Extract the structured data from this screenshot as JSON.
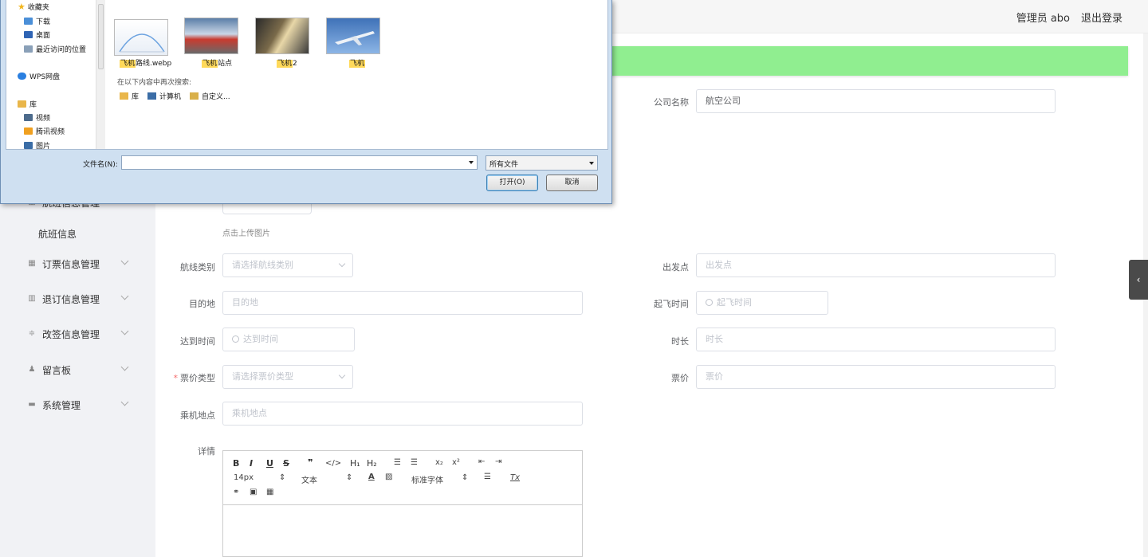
{
  "header": {
    "admin": "管理员 abo",
    "logout": "退出登录"
  },
  "sidebar": {
    "partial_item": "航班信息管理",
    "sub_item": "航班信息",
    "items": [
      {
        "label": "订票信息管理",
        "icon": "grid-icon"
      },
      {
        "label": "退订信息管理",
        "icon": "bars-icon"
      },
      {
        "label": "改签信息管理",
        "icon": "sliders-icon"
      },
      {
        "label": "留言板",
        "icon": "user-icon"
      },
      {
        "label": "系统管理",
        "icon": "system-icon"
      }
    ]
  },
  "form": {
    "company": {
      "label": "公司名称",
      "value": "航空公司"
    },
    "upload_hint": "点击上传图片",
    "route_type": {
      "label": "航线类别",
      "placeholder": "请选择航线类别"
    },
    "departure": {
      "label": "出发点",
      "placeholder": "出发点"
    },
    "destination": {
      "label": "目的地",
      "placeholder": "目的地"
    },
    "takeoff_time": {
      "label": "起飞时间",
      "placeholder": "起飞时间"
    },
    "arrival_time": {
      "label": "达到时间",
      "placeholder": "达到时间"
    },
    "duration": {
      "label": "时长",
      "placeholder": "时长"
    },
    "fare_type": {
      "label": "票价类型",
      "placeholder": "请选择票价类型",
      "required": "*"
    },
    "fare": {
      "label": "票价",
      "placeholder": "票价"
    },
    "boarding": {
      "label": "乘机地点",
      "placeholder": "乘机地点"
    },
    "details": {
      "label": "详情"
    }
  },
  "editor": {
    "bold": "B",
    "italic": "I",
    "underline": "U",
    "strike": "S",
    "quote": "❞",
    "code": "</>",
    "h1": "H₁",
    "h2": "H₂",
    "ol": "☰",
    "ul": "☰",
    "sub": "x₂",
    "sup": "x²",
    "outdent": "⇤",
    "indent": "⇥",
    "font_size": "14px",
    "block": "文本",
    "font_family": "标准字体",
    "clear": "Tx"
  },
  "dialog": {
    "nav": [
      {
        "label": "收藏夹",
        "color": "#f2b61d"
      },
      {
        "label": "下载",
        "color": "#4a8fd8"
      },
      {
        "label": "桌面",
        "color": "#2f64b4"
      },
      {
        "label": "最近访问的位置",
        "color": "#8aa0b8"
      },
      {
        "label": "WPS网盘",
        "color": "#2a7fe0"
      },
      {
        "label": "库",
        "color": "#e9b64a"
      },
      {
        "label": "视频",
        "color": "#4d6b8c"
      },
      {
        "label": "腾讯视频",
        "color": "#f0a020"
      },
      {
        "label": "图片",
        "color": "#3b6da6"
      }
    ],
    "files": [
      {
        "name_hl": "飞机",
        "name_rest": "路线.webp"
      },
      {
        "name_hl": "飞机",
        "name_rest": "站点"
      },
      {
        "name_hl": "飞机",
        "name_rest": "2"
      },
      {
        "name_hl": "飞机",
        "name_rest": ""
      }
    ],
    "search_again": "在以下内容中再次搜索:",
    "search_locations": [
      {
        "label": "库",
        "color": "#e9b64a"
      },
      {
        "label": "计算机",
        "color": "#3b6da6"
      },
      {
        "label": "自定义...",
        "color": "#d9b04a"
      }
    ],
    "filename_label": "文件名(N):",
    "filename_value": "",
    "filetype": "所有文件",
    "open_button": "打开(O)",
    "cancel_button": "取消"
  }
}
